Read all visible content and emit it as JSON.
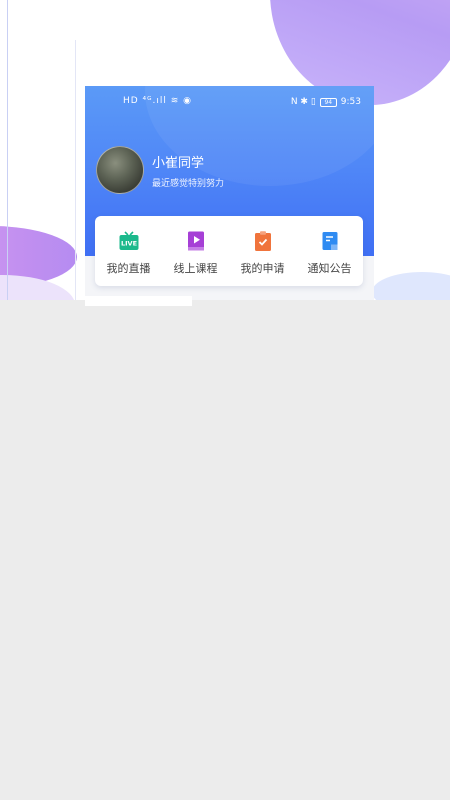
{
  "status_bar": {
    "left_icons": "HD ⁴ᴳ.ıll ≋ ◉",
    "right_icons": "N ✱ ▯",
    "battery": "94",
    "time": "9:53"
  },
  "profile": {
    "name": "小崔同学",
    "subtitle": "最近感觉特别努力"
  },
  "menu": {
    "items": [
      {
        "label": "我的直播",
        "icon": "live-tv-icon",
        "color": "#1bb98c"
      },
      {
        "label": "线上课程",
        "icon": "video-book-icon",
        "color": "#a63fd6"
      },
      {
        "label": "我的申请",
        "icon": "clipboard-check-icon",
        "color": "#f0743c"
      },
      {
        "label": "通知公告",
        "icon": "notice-doc-icon",
        "color": "#2f8bf2"
      }
    ]
  },
  "colors": {
    "header_top": "#5b9af7",
    "header_bottom": "#3f6ff4",
    "background": "#ececec"
  }
}
